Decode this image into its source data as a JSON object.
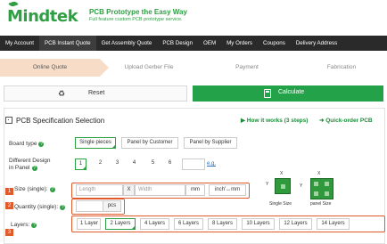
{
  "brand": {
    "logo_text": "Mindtek",
    "tagline_title": "PCB Prototype the Easy Way",
    "tagline_sub": "Full feature custom PCB prototype service."
  },
  "nav": {
    "items": [
      {
        "label": "My Account"
      },
      {
        "label": "PCB Instant Quote"
      },
      {
        "label": "Get Assembly Quote"
      },
      {
        "label": "PCB Design"
      },
      {
        "label": "OEM"
      },
      {
        "label": "My Orders"
      },
      {
        "label": "Coupons"
      },
      {
        "label": "Delivery Address"
      }
    ],
    "active_index": 1
  },
  "steps": {
    "items": [
      {
        "label": "Online Quote"
      },
      {
        "label": "Upload Gerber File"
      },
      {
        "label": "Payment"
      },
      {
        "label": "Fabrication"
      }
    ],
    "active_index": 0
  },
  "actions": {
    "reset_label": "Reset",
    "calculate_label": "Calculate"
  },
  "spec": {
    "title": "PCB Specification Selection",
    "how_it_works": "▶ How it works (3 steps)",
    "quick_order": "➜ Quick-order PCB",
    "board_type": {
      "label": "Board type",
      "options": [
        "Single pieces",
        "Panel by Customer",
        "Panel by Supplier"
      ],
      "selected": "Single pieces"
    },
    "different_design": {
      "label_line1": "Different Design",
      "label_line2": "in Panel",
      "options": [
        "1",
        "2",
        "3",
        "4",
        "5",
        "6"
      ],
      "selected": "1",
      "eg_link": "e.g."
    },
    "size": {
      "label": "Size (single):",
      "badge": "1",
      "length_placeholder": "Length",
      "x_label": "X",
      "width_placeholder": "Width",
      "mm_label": "mm",
      "unit_toggle": "inch'↔mm"
    },
    "quantity": {
      "label": "Quantity (single):",
      "badge": "2",
      "unit": "pcs"
    },
    "layers": {
      "label": "Layers:",
      "badge": "3",
      "options": [
        "1 Layer",
        "2 Layers",
        "4 Layers",
        "6 Layers",
        "8 Layers",
        "10 Layers",
        "12 Layers",
        "14 Layers"
      ],
      "selected": "2 Layers"
    },
    "illustration": {
      "single_caption": "Single Size",
      "panel_caption": "panel Size",
      "dim_x": "X",
      "dim_y": "Y"
    }
  },
  "colors": {
    "brand_green": "#2ea043",
    "nav_bg": "#2a2a2a",
    "step_active": "#f7ddc8",
    "calculate_bg": "#24a24a",
    "highlight_orange": "#e05a2b"
  }
}
